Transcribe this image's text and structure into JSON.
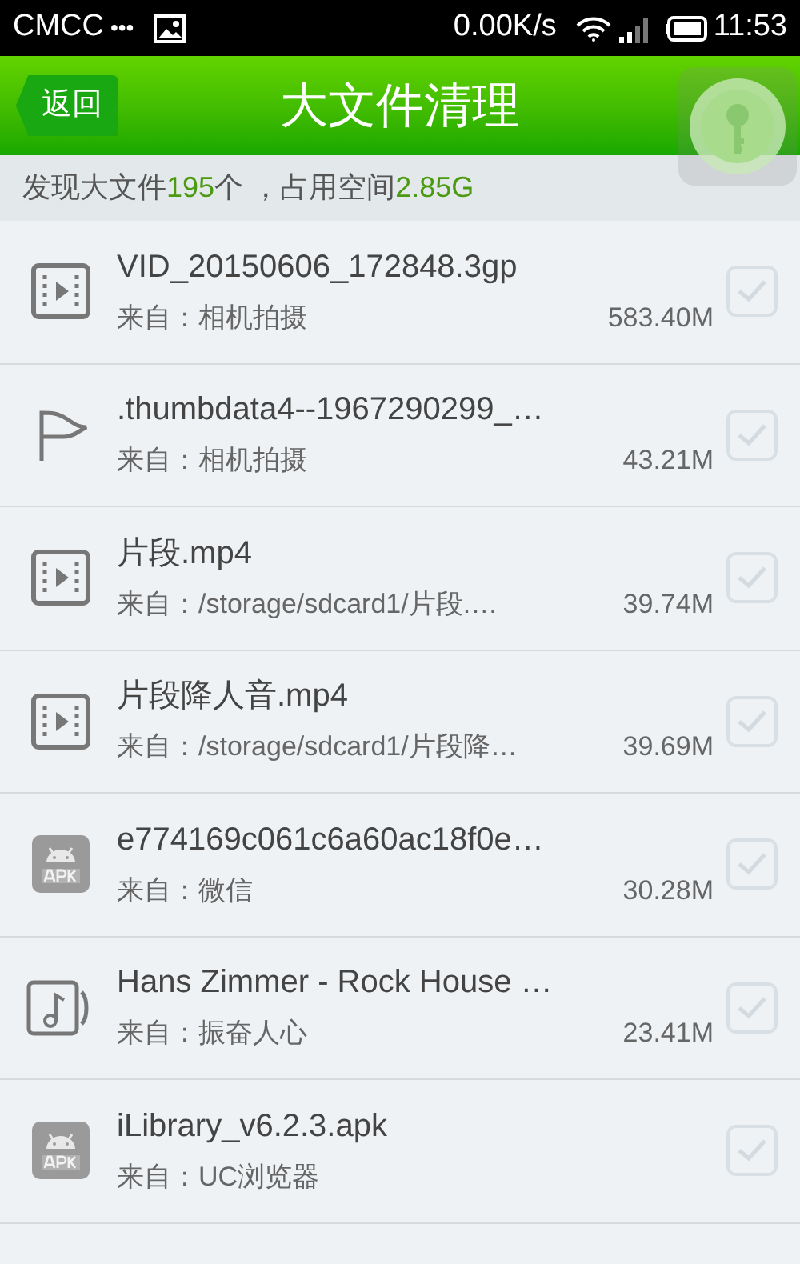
{
  "status_bar": {
    "carrier": "CMCC",
    "dots": "•••",
    "speed": "0.00K/s",
    "time": "11:53"
  },
  "header": {
    "back": "返回",
    "title": "大文件清理"
  },
  "summary": [
    {
      "text": "发现大文件",
      "kind": "plain"
    },
    {
      "text": "195",
      "kind": "highlight"
    },
    {
      "text": "个 ，占用空间",
      "kind": "plain"
    },
    {
      "text": "2.85G",
      "kind": "highlight"
    }
  ],
  "files": [
    {
      "kind": "video",
      "name": "VID_20150606_172848.3gp",
      "source": "来自：相机拍摄",
      "size": "583.40M",
      "checked": false
    },
    {
      "kind": "flag",
      "name": ".thumbdata4--1967290299_…",
      "source": "来自：相机拍摄",
      "size": "43.21M",
      "checked": false
    },
    {
      "kind": "video",
      "name": "片段.mp4",
      "source": "来自：/storage/sdcard1/片段.…",
      "size": "39.74M",
      "checked": false
    },
    {
      "kind": "video",
      "name": "片段降人音.mp4",
      "source": "来自：/storage/sdcard1/片段降…",
      "size": "39.69M",
      "checked": false
    },
    {
      "kind": "apk",
      "name": "e774169c061c6a60ac18f0e…",
      "source": "来自：微信",
      "size": "30.28M",
      "checked": false
    },
    {
      "kind": "music",
      "name": "Hans Zimmer - Rock House …",
      "source": "来自：振奋人心",
      "size": "23.41M",
      "checked": false
    },
    {
      "kind": "apk",
      "name": "iLibrary_v6.2.3.apk",
      "source": "来自：UC浏览器",
      "checked": false
    }
  ]
}
